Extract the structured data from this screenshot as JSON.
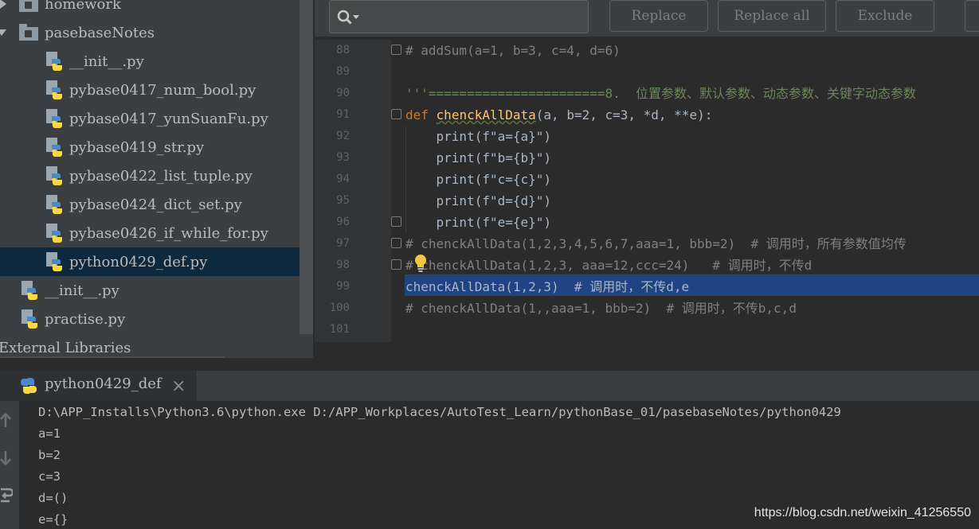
{
  "project_tree": {
    "items": [
      {
        "label": "homework",
        "icon": "folder-icon",
        "arrow": "right"
      },
      {
        "label": "pasebaseNotes",
        "icon": "folder-icon",
        "arrow": "down"
      },
      {
        "label": "__init__.py",
        "icon": "python-file-icon"
      },
      {
        "label": "pybase0417_num_bool.py",
        "icon": "python-file-icon"
      },
      {
        "label": "pybase0417_yunSuanFu.py",
        "icon": "python-file-icon"
      },
      {
        "label": "pybase0419_str.py",
        "icon": "python-file-icon"
      },
      {
        "label": "pybase0422_list_tuple.py",
        "icon": "python-file-icon"
      },
      {
        "label": "pybase0424_dict_set.py",
        "icon": "python-file-icon"
      },
      {
        "label": "pybase0426_if_while_for.py",
        "icon": "python-file-icon"
      },
      {
        "label": "python0429_def.py",
        "icon": "python-file-icon",
        "selected": true
      },
      {
        "label": "__init__.py",
        "icon": "python-file-icon"
      },
      {
        "label": "practise.py",
        "icon": "python-file-icon"
      },
      {
        "label": "External Libraries"
      }
    ]
  },
  "find_bar": {
    "search_value": "",
    "replace_label": "Replace",
    "replace_all_label": "Replace all",
    "exclude_label": "Exclude"
  },
  "editor": {
    "line_numbers": [
      "88",
      "89",
      "90",
      "91",
      "92",
      "93",
      "94",
      "95",
      "96",
      "97",
      "98",
      "99",
      "100",
      "101"
    ],
    "lines": {
      "l88": "# addSum(a=1, b=3, c=4, d=6)",
      "l90": "'''=======================8.  位置参数、默认参数、动态参数、关键字动态参数",
      "l91_kw": "def",
      "l91_fn": "chenckAllData",
      "l91_rest": "(a, b=2, c=3, *d, **e):",
      "l92": "    print(f\"a={a}\")",
      "l93": "    print(f\"b={b}\")",
      "l94": "    print(f\"c={c}\")",
      "l95": "    print(f\"d={d}\")",
      "l96": "    print(f\"e={e}\")",
      "l97": "# chenckAllData(1,2,3,4,5,6,7,aaa=1, bbb=2)  # 调用时，所有参数值均传",
      "l98": "# chenckAllData(1,2,3, aaa=12,ccc=24)   # 调用时，不传d",
      "l99": "chenckAllData(1,2,3)  # 调用时，不传d,e",
      "l100": "# chenckAllData(1,,aaa=1, bbb=2)  # 调用时，不传b,c,d"
    }
  },
  "run_panel": {
    "tab_label": "python0429_def",
    "close_glyph": "×",
    "output": [
      "D:\\APP_Installs\\Python3.6\\python.exe D:/APP_Workplaces/AutoTest_Learn/pythonBase_01/pasebaseNotes/python0429",
      "a=1",
      "b=2",
      "c=3",
      "d=()",
      "e={}"
    ]
  },
  "watermark": "https://blog.csdn.net/weixin_41256550",
  "colors": {
    "panel_bg": "#3c3f41",
    "editor_bg": "#2b2b2b",
    "selection": "#214283",
    "keyword": "#cc7832",
    "function": "#ffc66d",
    "string": "#6a8759",
    "comment": "#808080",
    "number": "#6897bb"
  }
}
